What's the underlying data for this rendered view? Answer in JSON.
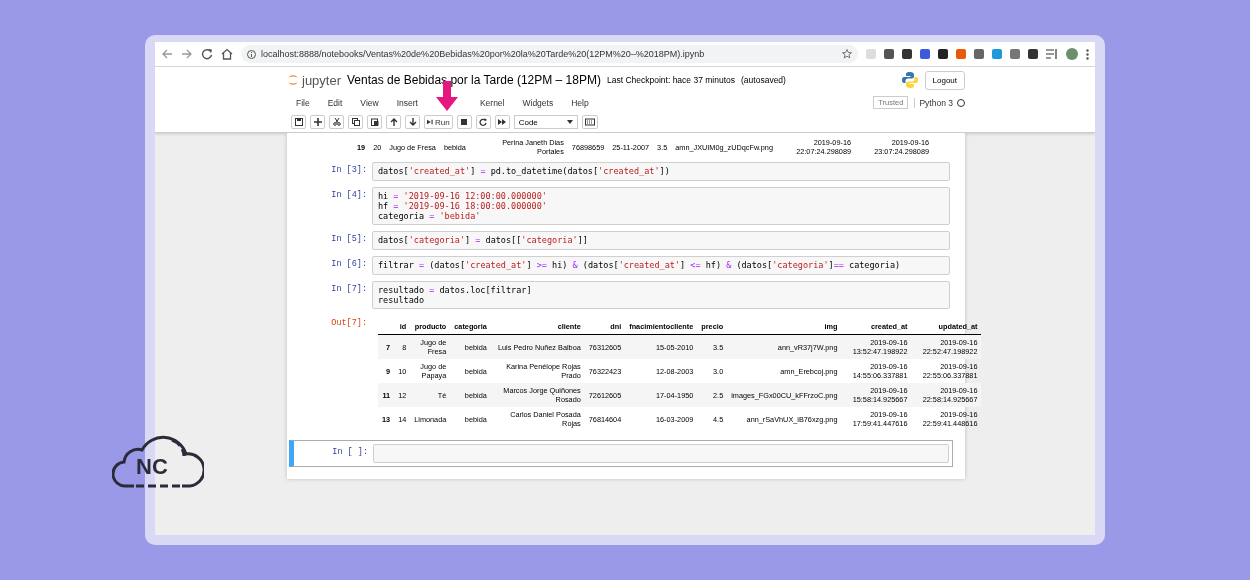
{
  "browser": {
    "url": "localhost:8888/notebooks/Ventas%20de%20Bebidas%20por%20la%20Tarde%20(12PM%20–%2018PM).ipynb"
  },
  "header": {
    "logo_text": "jupyter",
    "title": "Ventas de Bebidas por la Tarde (12PM – 18PM)",
    "checkpoint": "Last Checkpoint: hace 37 minutos",
    "autosaved": "(autosaved)",
    "logout": "Logout"
  },
  "menu": {
    "left": [
      "File",
      "Edit",
      "View",
      "Insert"
    ],
    "right": [
      "Kernel",
      "Widgets",
      "Help"
    ]
  },
  "kernel": {
    "trusted": "Trusted",
    "name": "Python 3",
    "busy": false
  },
  "toolbar": {
    "buttons": [
      {
        "kind": "save"
      },
      {
        "kind": "plus"
      },
      {
        "kind": "cut"
      },
      {
        "kind": "copy"
      },
      {
        "kind": "paste"
      },
      {
        "kind": "up"
      },
      {
        "kind": "down"
      },
      {
        "kind": "run",
        "label": "Run"
      },
      {
        "kind": "stop"
      },
      {
        "kind": "restart"
      },
      {
        "kind": "fastforward"
      }
    ],
    "cell_type": "Code"
  },
  "previous_output_rows": [
    [
      "19",
      "20",
      "Jugo de Fresa",
      "bebida",
      "Perina Janeth Dias Portales",
      "76898659",
      "25-11-2007",
      "3.5",
      "amn_JXUIM0g_zUDqcFw.png",
      "2019-09-16 22:07:24.298089",
      "2019-09-16 23:07:24.298089"
    ]
  ],
  "cells": [
    {
      "prompt": "In [3]:",
      "selected": false,
      "lines": [
        [
          {
            "text": "datos[",
            "kind": "plain"
          },
          {
            "text": "'created_at'",
            "kind": "str"
          },
          {
            "text": "] ",
            "kind": "plain"
          },
          {
            "text": "=",
            "kind": "op"
          },
          {
            "text": " pd.to_datetime(datos[",
            "kind": "plain"
          },
          {
            "text": "'created_at'",
            "kind": "str"
          },
          {
            "text": "])",
            "kind": "plain"
          }
        ]
      ]
    },
    {
      "prompt": "In [4]:",
      "selected": false,
      "lines": [
        [
          {
            "text": "hi ",
            "kind": "plain"
          },
          {
            "text": "= ",
            "kind": "op"
          },
          {
            "text": "'2019-09-16 12:00:00.000000'",
            "kind": "str"
          }
        ],
        [
          {
            "text": "hf ",
            "kind": "plain"
          },
          {
            "text": "= ",
            "kind": "op"
          },
          {
            "text": "'2019-09-16 18:00:00.000000'",
            "kind": "str"
          }
        ],
        [
          {
            "text": "categoria ",
            "kind": "plain"
          },
          {
            "text": "= ",
            "kind": "op"
          },
          {
            "text": "'bebida'",
            "kind": "str"
          }
        ]
      ]
    },
    {
      "prompt": "In [5]:",
      "selected": false,
      "lines": [
        [
          {
            "text": "datos[",
            "kind": "plain"
          },
          {
            "text": "'categoria'",
            "kind": "str"
          },
          {
            "text": "] ",
            "kind": "plain"
          },
          {
            "text": "=",
            "kind": "op"
          },
          {
            "text": " datos[[",
            "kind": "plain"
          },
          {
            "text": "'categoria'",
            "kind": "str"
          },
          {
            "text": "]]",
            "kind": "plain"
          }
        ]
      ]
    },
    {
      "prompt": "In [6]:",
      "selected": false,
      "lines": [
        [
          {
            "text": "filtrar ",
            "kind": "plain"
          },
          {
            "text": "=",
            "kind": "op"
          },
          {
            "text": " (datos[",
            "kind": "plain"
          },
          {
            "text": "'created_at'",
            "kind": "str"
          },
          {
            "text": "] ",
            "kind": "plain"
          },
          {
            "text": ">=",
            "kind": "op"
          },
          {
            "text": " hi) ",
            "kind": "plain"
          },
          {
            "text": "&",
            "kind": "op"
          },
          {
            "text": " (datos[",
            "kind": "plain"
          },
          {
            "text": "'created_at'",
            "kind": "str"
          },
          {
            "text": "] ",
            "kind": "plain"
          },
          {
            "text": "<=",
            "kind": "op"
          },
          {
            "text": " hf) ",
            "kind": "plain"
          },
          {
            "text": "&",
            "kind": "op"
          },
          {
            "text": " (datos[",
            "kind": "plain"
          },
          {
            "text": "'categoria'",
            "kind": "str"
          },
          {
            "text": "]",
            "kind": "plain"
          },
          {
            "text": "==",
            "kind": "op"
          },
          {
            "text": " categoria)",
            "kind": "plain"
          }
        ]
      ]
    },
    {
      "prompt": "In [7]:",
      "selected": false,
      "lines": [
        [
          {
            "text": "resultado ",
            "kind": "plain"
          },
          {
            "text": "=",
            "kind": "op"
          },
          {
            "text": " datos.loc[filtrar]",
            "kind": "plain"
          }
        ],
        [
          {
            "text": "resultado",
            "kind": "plain"
          }
        ]
      ],
      "output": {
        "prompt": "Out[7]:",
        "columns": [
          "",
          "id",
          "producto",
          "categoria",
          "cliente",
          "dni",
          "fnacimientocliente",
          "precio",
          "img",
          "created_at",
          "updated_at"
        ],
        "rows": [
          [
            "7",
            "8",
            "Jugo de Fresa",
            "bebida",
            "Luis Pedro Nuñez Balboa",
            "76312605",
            "15-05-2010",
            "3.5",
            "ann_vR37j7W.png",
            "2019-09-16 13:52:47.198922",
            "2019-09-16 22:52:47.198922"
          ],
          [
            "9",
            "10",
            "Jugo de Papaya",
            "bebida",
            "Karina Penélope Rojas Prado",
            "76322423",
            "12-08-2003",
            "3.0",
            "amn_Erebcoj.png",
            "2019-09-16 14:55:06.337881",
            "2019-09-16 22:55:06.337881"
          ],
          [
            "11",
            "12",
            "Té",
            "bebida",
            "Marcos Jorge Quiñones Rosado",
            "72612605",
            "17-04-1950",
            "2.5",
            "images_FGx00CU_kFFrzoC.png",
            "2019-09-16 15:58:14.925667",
            "2019-09-16 22:58:14.925667"
          ],
          [
            "13",
            "14",
            "Limonada",
            "bebida",
            "Carlos Daniel Posada Rojas",
            "76814604",
            "16-03-2009",
            "4.5",
            "ann_rSaVhUX_iB76xzg.png",
            "2019-09-16 17:59:41.447616",
            "2019-09-16 22:59:41.448616"
          ]
        ]
      }
    },
    {
      "prompt": "In [ ]:",
      "selected": true
    }
  ],
  "logo": {
    "text": "NC"
  }
}
